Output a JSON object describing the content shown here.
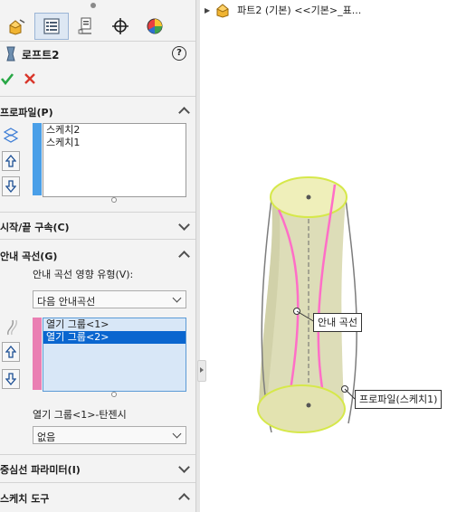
{
  "feature_manager": {
    "tabs": [
      {
        "name": "feature-tree"
      },
      {
        "name": "property-manager"
      },
      {
        "name": "configuration-manager"
      },
      {
        "name": "dimxpert-manager"
      },
      {
        "name": "display-manager"
      }
    ]
  },
  "property_manager": {
    "title": "로프트2",
    "help": "?",
    "sections": {
      "profile": {
        "label": "프로파일(P)",
        "items": [
          "스케치2",
          "스케치1"
        ]
      },
      "start_end": {
        "label": "시작/끝 구속(C)"
      },
      "guide_curves": {
        "label": "안내 곡선(G)",
        "influence_label": "안내 곡선 영향 유형(V):",
        "influence_value": "다음 안내곡선",
        "items": [
          "열기 그룹<1>",
          "열기 그룹<2>"
        ],
        "selected_index": 1,
        "tangency_label": "열기 그룹<1>-탄젠시",
        "tangency_value": "없음"
      },
      "centerline": {
        "label": "중심선 파라미터(I)"
      },
      "sketch_tools": {
        "label": "스케치 도구"
      }
    }
  },
  "graphics": {
    "tree_label": "파트2 (기본) <<기본>_표...",
    "callouts": {
      "guide": "안내 곡선",
      "profile": "프로파일(스케치1)"
    }
  },
  "colors": {
    "profile_bar": "#4a9fe8",
    "guide_bar": "#ea7fb3",
    "selection": "#0a66cf",
    "loft_surface": "#ddddb8",
    "guide_curve": "#ff6ec7",
    "profile_edge": "#d6e84a"
  }
}
